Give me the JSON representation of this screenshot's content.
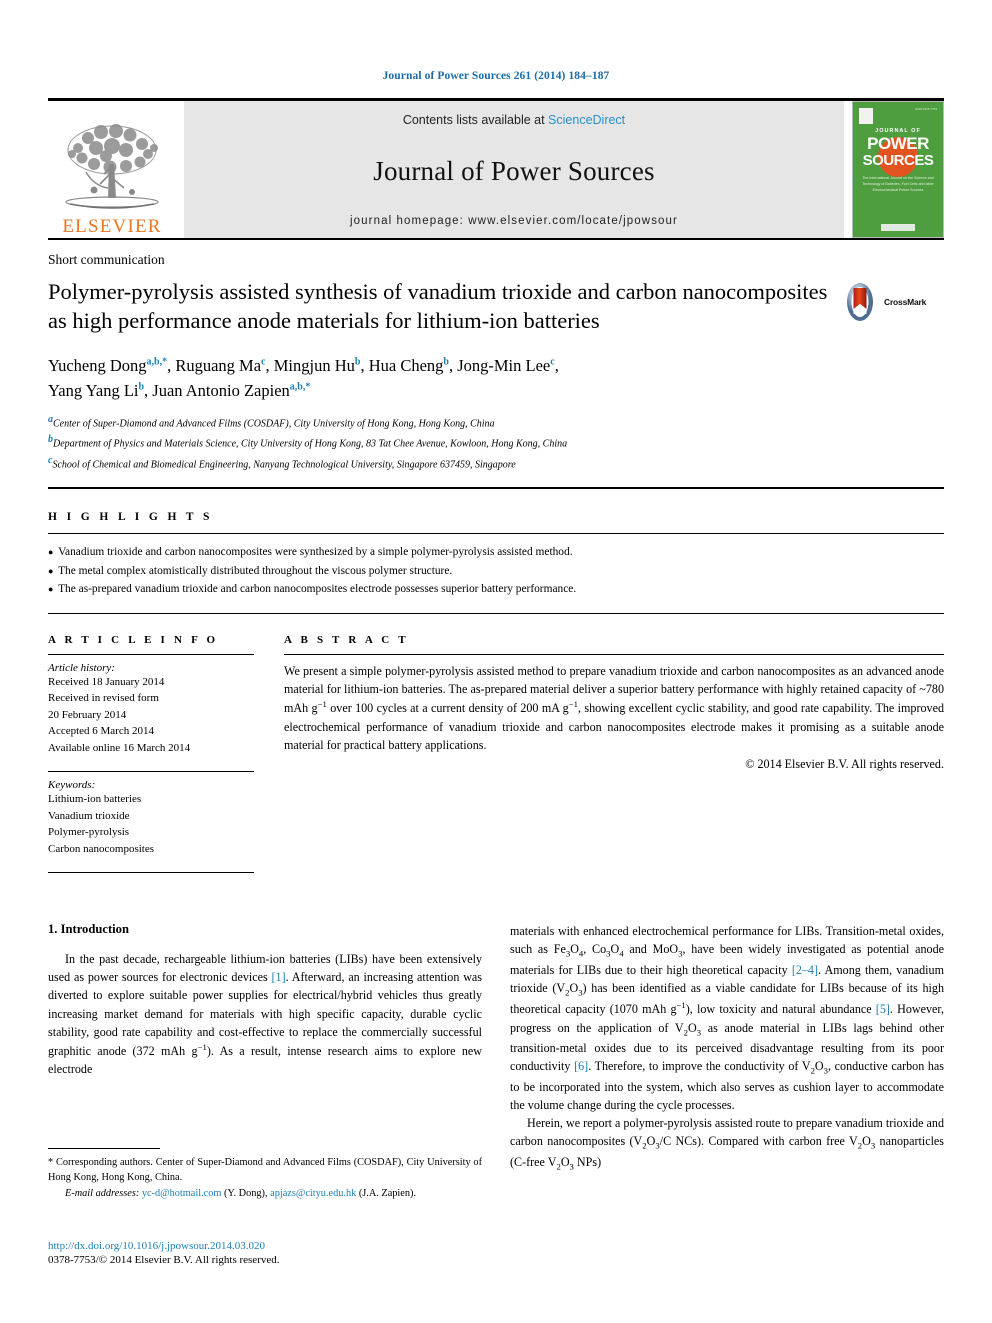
{
  "running_head": "Journal of Power Sources 261 (2014) 184–187",
  "masthead": {
    "contents_prefix": "Contents lists available at ",
    "contents_link": "ScienceDirect",
    "journal_title": "Journal of Power Sources",
    "homepage": "journal homepage: www.elsevier.com/locate/jpowsour",
    "publisher_wordmark": "ELSEVIER",
    "cover": {
      "line1": "JOURNAL OF",
      "line2": "POWER",
      "line3": "SOURCES",
      "blurb": "The International Journal on the Science and Technology of Batteries, Fuel Cells and other Electrochemical Power Sources",
      "footer": "Available online at\nScienceDirect"
    }
  },
  "article": {
    "type": "Short communication",
    "title": "Polymer-pyrolysis assisted synthesis of vanadium trioxide and carbon nanocomposites as high performance anode materials for lithium-ion batteries",
    "crossmark_label": "CrossMark",
    "authors_line1": "Yucheng Dong",
    "authors": [
      {
        "name": "Yucheng Dong",
        "sup": "a,b,*"
      },
      {
        "name": "Ruguang Ma",
        "sup": "c"
      },
      {
        "name": "Mingjun Hu",
        "sup": "b"
      },
      {
        "name": "Hua Cheng",
        "sup": "b"
      },
      {
        "name": "Jong-Min Lee",
        "sup": "c"
      },
      {
        "name": "Yang Yang Li",
        "sup": "b"
      },
      {
        "name": "Juan Antonio Zapien",
        "sup": "a,b,*"
      }
    ],
    "affiliations": [
      {
        "marker": "a",
        "text": "Center of Super-Diamond and Advanced Films (COSDAF), City University of Hong Kong, Hong Kong, China"
      },
      {
        "marker": "b",
        "text": "Department of Physics and Materials Science, City University of Hong Kong, 83 Tat Chee Avenue, Kowloon, Hong Kong, China"
      },
      {
        "marker": "c",
        "text": "School of Chemical and Biomedical Engineering, Nanyang Technological University, Singapore 637459, Singapore"
      }
    ]
  },
  "highlights": {
    "heading": "H I G H L I G H T S",
    "items": [
      "Vanadium trioxide and carbon nanocomposites were synthesized by a simple polymer-pyrolysis assisted method.",
      "The metal complex atomistically distributed throughout the viscous polymer structure.",
      "The as-prepared vanadium trioxide and carbon nanocomposites electrode possesses superior battery performance."
    ]
  },
  "article_info": {
    "heading": "A R T I C L E  I N F O",
    "history_label": "Article history:",
    "history": [
      "Received 18 January 2014",
      "Received in revised form",
      "20 February 2014",
      "Accepted 6 March 2014",
      "Available online 16 March 2014"
    ],
    "keywords_label": "Keywords:",
    "keywords": [
      "Lithium-ion batteries",
      "Vanadium trioxide",
      "Polymer-pyrolysis",
      "Carbon nanocomposites"
    ]
  },
  "abstract": {
    "heading": "A B S T R A C T",
    "text_part1": "We present a simple polymer-pyrolysis assisted method to prepare vanadium trioxide and carbon nanocomposites as an advanced anode material for lithium-ion batteries. The as-prepared material deliver a superior battery performance with highly retained capacity of ~780 mAh g",
    "sup1": "−1",
    "text_part2": " over 100 cycles at a current density of 200 mA g",
    "sup2": "−1",
    "text_part3": ", showing excellent cyclic stability, and good rate capability. The improved electrochemical performance of vanadium trioxide and carbon nanocomposites electrode makes it promising as a suitable anode material for practical battery applications.",
    "copyright": "© 2014 Elsevier B.V. All rights reserved."
  },
  "body": {
    "section_title": "1. Introduction",
    "left_para1_a": "In the past decade, rechargeable lithium-ion batteries (LIBs) have been extensively used as power sources for electronic devices ",
    "left_ref1": "[1]",
    "left_para1_b": ". Afterward, an increasing attention was diverted to explore suitable power supplies for electrical/hybrid vehicles thus greatly increasing market demand for materials with high specific capacity, durable cyclic stability, good rate capability and cost-effective to replace the commercially successful graphitic anode (372 mAh g",
    "left_sup": "−1",
    "left_para1_c": "). As a result, intense research aims to explore new electrode",
    "right_para1_a": "materials with enhanced electrochemical performance for LIBs. Transition-metal oxides, such as Fe",
    "right_para1_b": "O",
    "right_para1_c": ", Co",
    "right_para1_d": "O",
    "right_para1_e": " and MoO",
    "right_para1_f": ", have been widely investigated as potential anode materials for LIBs due to their high theoretical capacity ",
    "right_ref24": "[2–4]",
    "right_para1_g": ". Among them, vanadium trioxide (V",
    "right_para1_h": "O",
    "right_para1_i": ") has been identified as a viable candidate for LIBs because of its high theoretical capacity (1070 mAh g",
    "right_sup": "−1",
    "right_para1_j": "), low toxicity and natural abundance ",
    "right_ref5": "[5]",
    "right_para1_k": ". However, progress on the application of V",
    "right_para1_l": " as anode material in LIBs lags behind other transition-metal oxides due to its perceived disadvantage resulting from its poor conductivity ",
    "right_ref6": "[6]",
    "right_para1_m": ". Therefore, to improve the conductivity of V",
    "right_para1_n": ", conductive carbon has to be incorporated into the system, which also serves as cushion layer to accommodate the volume change during the cycle processes.",
    "right_para2_a": "Herein, we report a polymer-pyrolysis assisted route to prepare vanadium trioxide and carbon nanocomposites (V",
    "right_para2_b": "O",
    "right_para2_c": "/C NCs). Compared with carbon free V",
    "right_para2_d": "O",
    "right_para2_e": " nanoparticles (C-free V",
    "right_para2_f": "O",
    "right_para2_g": " NPs)"
  },
  "footnote": {
    "corresponding": "* Corresponding authors. Center of Super-Diamond and Advanced Films (COSDAF), City University of Hong Kong, Hong Kong, China.",
    "email_label": "E-mail addresses:",
    "email1": "yc-d@hotmail.com",
    "email1_who": "(Y. Dong),",
    "email2": "apjazs@cityu.edu.hk",
    "email2_who": "(J.A. Zapien).",
    "doi": "http://dx.doi.org/10.1016/j.jpowsour.2014.03.020",
    "issn": "0378-7753/© 2014 Elsevier B.V. All rights reserved."
  },
  "colors": {
    "link": "#1b7fb5",
    "sciencedirect": "#2a8fc9",
    "elsevier_orange": "#e87722",
    "cover_green": "#4e9d3f"
  }
}
